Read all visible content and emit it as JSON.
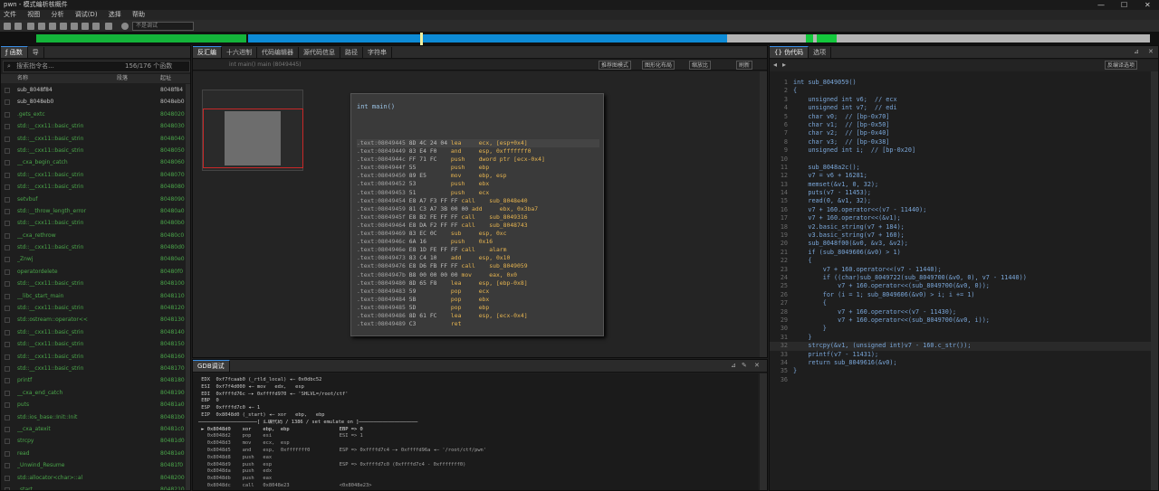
{
  "window": {
    "title": "pwn - 模式编析核概件",
    "min": "—",
    "max": "☐",
    "close": "✕"
  },
  "menu": [
    "文件",
    "视图",
    "分析",
    "调试(D)",
    "选择",
    "帮助"
  ],
  "toolbar": {
    "combo": "不是调试"
  },
  "funcs": {
    "tab": "函数",
    "tab2": "导",
    "search_placeholder": "搜索指令名...",
    "count": "156/176 个函数",
    "col_name": "名称",
    "col_seg": "段落",
    "col_addr": "起址",
    "rows": [
      {
        "name": "sub_8048f84",
        "addr": "8048f84",
        "lib": false
      },
      {
        "name": "sub_8048eb0",
        "addr": "8048eb0",
        "lib": false
      },
      {
        "name": ".gets_extc",
        "addr": "8048020",
        "lib": true
      },
      {
        "name": "std::__cxx11::basic_strin",
        "addr": "8048030",
        "lib": true
      },
      {
        "name": "std::__cxx11::basic_strin",
        "addr": "8048040",
        "lib": true
      },
      {
        "name": "std::__cxx11::basic_strin",
        "addr": "8048050",
        "lib": true
      },
      {
        "name": "__cxa_begin_catch",
        "addr": "8048060",
        "lib": true
      },
      {
        "name": "std::__cxx11::basic_strin",
        "addr": "8048070",
        "lib": true
      },
      {
        "name": "std::__cxx11::basic_strin",
        "addr": "8048080",
        "lib": true
      },
      {
        "name": "setvbuf",
        "addr": "8048090",
        "lib": true
      },
      {
        "name": "std::__throw_length_error",
        "addr": "80480a0",
        "lib": true
      },
      {
        "name": "std::__cxx11::basic_strin",
        "addr": "80480b0",
        "lib": true
      },
      {
        "name": "__cxa_rethrow",
        "addr": "80480c0",
        "lib": true
      },
      {
        "name": "std::__cxx11::basic_strin",
        "addr": "80480d0",
        "lib": true
      },
      {
        "name": "_Znwj",
        "addr": "80480e0",
        "lib": true
      },
      {
        "name": "operatordelete",
        "addr": "80480f0",
        "lib": true
      },
      {
        "name": "std::__cxx11::basic_strin",
        "addr": "8048100",
        "lib": true
      },
      {
        "name": "__libc_start_main",
        "addr": "8048110",
        "lib": true
      },
      {
        "name": "std::__cxx11::basic_strin",
        "addr": "8048120",
        "lib": true
      },
      {
        "name": "std::ostream::operator<<",
        "addr": "8048130",
        "lib": true
      },
      {
        "name": "std::__cxx11::basic_strin",
        "addr": "8048140",
        "lib": true
      },
      {
        "name": "std::__cxx11::basic_strin",
        "addr": "8048150",
        "lib": true
      },
      {
        "name": "std::__cxx11::basic_strin",
        "addr": "8048160",
        "lib": true
      },
      {
        "name": "std::__cxx11::basic_strin",
        "addr": "8048170",
        "lib": true
      },
      {
        "name": "printf",
        "addr": "8048180",
        "lib": true
      },
      {
        "name": "__cxa_end_catch",
        "addr": "8048190",
        "lib": true
      },
      {
        "name": "puts",
        "addr": "80481a0",
        "lib": true
      },
      {
        "name": "std::ios_base::Init::Init",
        "addr": "80481b0",
        "lib": true
      },
      {
        "name": "__cxa_atexit",
        "addr": "80481c0",
        "lib": true
      },
      {
        "name": "strcpy",
        "addr": "80481d0",
        "lib": true
      },
      {
        "name": "read",
        "addr": "80481e0",
        "lib": true
      },
      {
        "name": "_Unwind_Resume",
        "addr": "80481f0",
        "lib": true
      },
      {
        "name": "std::allocator<char>::al",
        "addr": "8048200",
        "lib": true
      },
      {
        "name": "_start",
        "addr": "8048210",
        "lib": true
      }
    ]
  },
  "disasm": {
    "tabs": [
      "反汇编",
      "十六进制",
      "代码编辑器",
      "源代码信息",
      "路径",
      "字符串"
    ],
    "path": "int main()  main (8049445)",
    "btn1": "推荐图模式",
    "btn2": "图形化布局",
    "btn3": "缩放比",
    "btn4": "刷新",
    "fn": "int main()",
    "lines": [
      {
        "a": ".text:08049445",
        "b": "8D 4C 24 04",
        "c": "lea     ecx, [esp+0x4]"
      },
      {
        "a": ".text:08049449",
        "b": "83 E4 F0   ",
        "c": "and     esp, 0xfffffff0"
      },
      {
        "a": ".text:0804944c",
        "b": "FF 71 FC   ",
        "c": "push    dword ptr [ecx-0x4]"
      },
      {
        "a": ".text:0804944f",
        "b": "55         ",
        "c": "push    ebp"
      },
      {
        "a": ".text:08049450",
        "b": "89 E5      ",
        "c": "mov     ebp, esp"
      },
      {
        "a": ".text:08049452",
        "b": "53         ",
        "c": "push    ebx"
      },
      {
        "a": ".text:08049453",
        "b": "51         ",
        "c": "push    ecx"
      },
      {
        "a": ".text:08049454",
        "b": "E8 A7 F3 FF FF",
        "c": "call    sub_8048e40"
      },
      {
        "a": ".text:08049459",
        "b": "81 C3 A7 3B 00 00",
        "c": "add     ebx, 0x3ba7"
      },
      {
        "a": ".text:0804945f",
        "b": "E8 B2 FE FF FF",
        "c": "call    sub_8049316"
      },
      {
        "a": ".text:08049464",
        "b": "E8 DA F2 FF FF",
        "c": "call    sub_8048743"
      },
      {
        "a": ".text:08049469",
        "b": "83 EC 0C   ",
        "c": "sub     esp, 0xc"
      },
      {
        "a": ".text:0804946c",
        "b": "6A 16      ",
        "c": "push    0x16"
      },
      {
        "a": ".text:0804946e",
        "b": "E8 1D FE FF FF",
        "c": "call    alarm"
      },
      {
        "a": ".text:08049473",
        "b": "83 C4 10   ",
        "c": "add     esp, 0x10"
      },
      {
        "a": ".text:08049476",
        "b": "E8 D6 FB FF FF",
        "c": "call    sub_8049059"
      },
      {
        "a": ".text:0804947b",
        "b": "B8 00 00 00 00",
        "c": "mov     eax, 0x0"
      },
      {
        "a": ".text:08049480",
        "b": "8D 65 F8   ",
        "c": "lea     esp, [ebp-0x8]"
      },
      {
        "a": ".text:08049483",
        "b": "59         ",
        "c": "pop     ecx"
      },
      {
        "a": ".text:08049484",
        "b": "5B         ",
        "c": "pop     ebx"
      },
      {
        "a": ".text:08049485",
        "b": "5D         ",
        "c": "pop     ebp"
      },
      {
        "a": ".text:08049486",
        "b": "8D 61 FC   ",
        "c": "lea     esp, [ecx-0x4]"
      },
      {
        "a": ".text:08049489",
        "b": "C3         ",
        "c": "ret"
      }
    ]
  },
  "term": {
    "tab": "GDB调试",
    "lines": [
      {
        "t": " EDX  0xf7fcaab0 (_rtld_local) ◂— 0x0dbc52",
        "c": "#c7c7c7"
      },
      {
        "t": " ESI  0xf7f4d000 ◂— mov   edx,   esp",
        "c": "#c7c7c7"
      },
      {
        "t": " EDI  0xffffd76c —▸ 0xffffd970 ◂— 'SHLVL=/root/ctf'",
        "c": "#c7c7c7"
      },
      {
        "t": " EBP  0",
        "c": "#c7c7c7"
      },
      {
        "t": " ESP  0xffffd7c0 ◂— 1",
        "c": "#c7c7c7"
      },
      {
        "t": " EIP  0x8048d0 (_start) ◂— xor   ebp,   ebp",
        "c": "#c7c7c7"
      },
      {
        "t": "────────────────────[ 汇编代码 / 1386 / set emulate on ]────────────────────",
        "c": "#d0d0d0"
      },
      {
        "t": " ► 0x8048d0    xor    ebp,  ebp                 EBP => 0",
        "c": "#e0e0e0"
      },
      {
        "t": "   0x8048d2    pop    esi                       ESI => 1",
        "c": "#a0a0a0"
      },
      {
        "t": "   0x8048d3    mov    ecx,  esp",
        "c": "#a0a0a0"
      },
      {
        "t": "   0x8048d5    and    esp,  0xfffffff0          ESP => 0xffffd7c4 —▸ 0xffffd96a ◂— '/root/ctf/pwn'",
        "c": "#a0a0a0"
      },
      {
        "t": "   0x8048d8    push   eax",
        "c": "#a0a0a0"
      },
      {
        "t": "   0x8048d9    push   esp                       ESP => 0xffffd7c0 (0xffffd7c4 - 0xfffffff0)",
        "c": "#a0a0a0"
      },
      {
        "t": "   0x8048da    push   edx",
        "c": "#a0a0a0"
      },
      {
        "t": "   0x8048db    push   eax",
        "c": "#a0a0a0"
      },
      {
        "t": "   0x8048dc    call   0x8048e23                 <0x8048e23>",
        "c": "#a0a0a0"
      }
    ]
  },
  "pseudo": {
    "tabs": [
      "伪代码",
      "选项"
    ],
    "btn": "反编译选项",
    "lines": [
      {
        "n": "1",
        "t": "int sub_8049059()",
        "hl": false
      },
      {
        "n": "2",
        "t": "{",
        "hl": false
      },
      {
        "n": "3",
        "t": "    unsigned int v6;  // ecx",
        "hl": false
      },
      {
        "n": "4",
        "t": "    unsigned int v7;  // edi",
        "hl": false
      },
      {
        "n": "5",
        "t": "    char v0;  // [bp-0x70]",
        "hl": false
      },
      {
        "n": "6",
        "t": "    char v1;  // [bp-0x50]",
        "hl": false
      },
      {
        "n": "7",
        "t": "    char v2;  // [bp-0x40]",
        "hl": false
      },
      {
        "n": "8",
        "t": "    char v3;  // [bp-0x38]",
        "hl": false
      },
      {
        "n": "9",
        "t": "    unsigned int i;  // [bp-0x20]",
        "hl": false
      },
      {
        "n": "10",
        "t": "",
        "hl": false
      },
      {
        "n": "11",
        "t": "    sub_8048a2c();",
        "hl": false
      },
      {
        "n": "12",
        "t": "    v7 = v6 + 16281;",
        "hl": false
      },
      {
        "n": "13",
        "t": "    memset(&v1, 0, 32);",
        "hl": false
      },
      {
        "n": "14",
        "t": "    puts(v7 - 11453);",
        "hl": false
      },
      {
        "n": "15",
        "t": "    read(0, &v1, 32);",
        "hl": false
      },
      {
        "n": "16",
        "t": "    v7 + 160.operator<<(v7 - 11440);",
        "hl": false
      },
      {
        "n": "17",
        "t": "    v7 + 160.operator<<(&v1);",
        "hl": false
      },
      {
        "n": "18",
        "t": "    v2.basic_string(v7 + 184);",
        "hl": false
      },
      {
        "n": "19",
        "t": "    v3.basic_string(v7 + 160);",
        "hl": false
      },
      {
        "n": "20",
        "t": "    sub_8048f00(&v0, &v3, &v2);",
        "hl": false
      },
      {
        "n": "21",
        "t": "    if (sub_8049606(&v0) > 1)",
        "hl": false
      },
      {
        "n": "22",
        "t": "    {",
        "hl": false
      },
      {
        "n": "23",
        "t": "        v7 + 160.operator<<(v7 - 11440);",
        "hl": false
      },
      {
        "n": "24",
        "t": "        if ((char)sub_8049722(sub_8049700(&v0, 0), v7 - 11440))",
        "hl": false
      },
      {
        "n": "25",
        "t": "            v7 + 160.operator<<(sub_8049700(&v0, 0));",
        "hl": false
      },
      {
        "n": "26",
        "t": "        for (i = 1; sub_8049606(&v0) > i; i += 1)",
        "hl": false
      },
      {
        "n": "27",
        "t": "        {",
        "hl": false
      },
      {
        "n": "28",
        "t": "            v7 + 160.operator<<(v7 - 11430);",
        "hl": false
      },
      {
        "n": "29",
        "t": "            v7 + 160.operator<<(sub_8049700(&v0, i));",
        "hl": false
      },
      {
        "n": "30",
        "t": "        }",
        "hl": false
      },
      {
        "n": "31",
        "t": "    }",
        "hl": false
      },
      {
        "n": "32",
        "t": "    strcpy(&v1, (unsigned int)v7 - 160.c_str());",
        "hl": true
      },
      {
        "n": "33",
        "t": "    printf(v7 - 11431);",
        "hl": false
      },
      {
        "n": "34",
        "t": "    return sub_8049616(&v0);",
        "hl": false
      },
      {
        "n": "35",
        "t": "}",
        "hl": false
      },
      {
        "n": "36",
        "t": "",
        "hl": false
      }
    ]
  },
  "colors": {
    "accent": "#0d8bd6",
    "green": "#14c83c",
    "lib": "#4aa54a",
    "addr": "#e6b450",
    "code": "#7aa6d8"
  }
}
